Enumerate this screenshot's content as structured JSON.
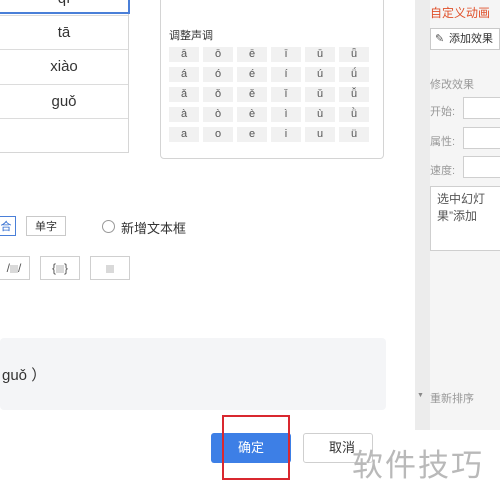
{
  "pinyin_list": [
    "qī",
    "tā",
    "xiào",
    "guǒ"
  ],
  "tone_panel": {
    "title": "调整声调",
    "rows": [
      [
        "ā",
        "ō",
        "ē",
        "ī",
        "ū",
        "ǖ"
      ],
      [
        "á",
        "ó",
        "é",
        "í",
        "ú",
        "ǘ"
      ],
      [
        "ǎ",
        "ǒ",
        "ě",
        "ǐ",
        "ǔ",
        "ǚ"
      ],
      [
        "à",
        "ò",
        "è",
        "ì",
        "ù",
        "ǜ"
      ],
      [
        "a",
        "o",
        "e",
        "i",
        "u",
        "ü"
      ]
    ]
  },
  "options": {
    "combined_label": "合",
    "single_label": "单字",
    "new_textbox_label": "新增文本框"
  },
  "format_options": {
    "slash_label": "/",
    "brace_open": "{",
    "brace_close": "}"
  },
  "preview": {
    "text": "guǒ ）"
  },
  "footer": {
    "ok_label": "确定",
    "cancel_label": "取消"
  },
  "sidebar": {
    "title": "自定义动画",
    "add_effect_label": "添加效果",
    "modify_label": "修改效果",
    "start_label": "开始:",
    "property_label": "属性:",
    "speed_label": "速度:",
    "desc_line1": "选中幻灯",
    "desc_line2": "果”添加",
    "reorder_label": "重新排序"
  },
  "watermark": "软件技巧"
}
